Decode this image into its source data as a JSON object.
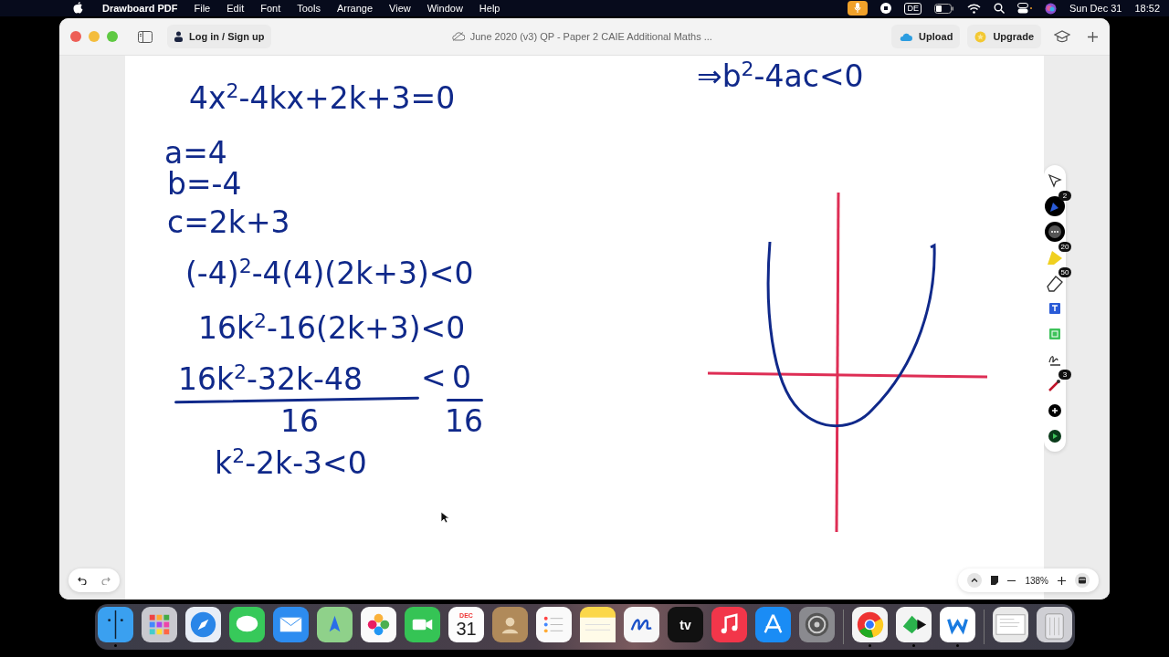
{
  "menu_bar": {
    "app_name": "Drawboard PDF",
    "menus": [
      "File",
      "Edit",
      "Font",
      "Tools",
      "Arrange",
      "View",
      "Window",
      "Help"
    ],
    "keyboard_layout": "DE",
    "date": "Sun Dec 31",
    "time": "18:52"
  },
  "window": {
    "title": "June 2020 (v3) QP - Paper 2 CAIE Additional Maths ...",
    "login_button": "Log in / Sign up",
    "upload_button": "Upload",
    "upgrade_button": "Upgrade"
  },
  "page": {
    "lines": [
      {
        "kind": "line",
        "text": "⇒b$^{2}$-4ac<0"
      },
      {
        "kind": "line",
        "text": "4x$^{2}$-4kx+2k+3=0"
      },
      {
        "kind": "line",
        "text": "a=4"
      },
      {
        "kind": "line",
        "text": "b=-4"
      },
      {
        "kind": "line",
        "text": "c=2k+3"
      },
      {
        "kind": "line",
        "text": "(-4)$^{2}$-4(4)(2k+3)<0"
      },
      {
        "kind": "line",
        "text": "16k$^{2}$-16(2k+3)<0"
      },
      {
        "kind": "fraction",
        "numerator": "16k$^{2}$-32k-48",
        "denominator": "16",
        "relation": "<",
        "rhs_numerator": "0",
        "rhs_denominator": "16"
      },
      {
        "kind": "line",
        "text": "k$^{2}$-2k-3<0"
      }
    ]
  },
  "tools": [
    {
      "kind": "select",
      "selected": false
    },
    {
      "kind": "pen",
      "selected": true,
      "badge": "2"
    },
    {
      "kind": "more",
      "selected": true
    },
    {
      "kind": "highlighter",
      "selected": false,
      "badge": "20"
    },
    {
      "kind": "eraser",
      "selected": false,
      "badge": "50"
    },
    {
      "kind": "text",
      "selected": false
    },
    {
      "kind": "shape",
      "selected": false
    },
    {
      "kind": "signature",
      "selected": false
    },
    {
      "kind": "laser",
      "selected": false,
      "badge": "3"
    },
    {
      "kind": "add",
      "selected": false
    },
    {
      "kind": "record",
      "selected": false
    }
  ],
  "zoom": {
    "level_text": "138%"
  },
  "dock": [
    {
      "kind": "finder",
      "running": true
    },
    {
      "kind": "launchpad",
      "running": false
    },
    {
      "kind": "safari",
      "running": false
    },
    {
      "kind": "messages",
      "running": false
    },
    {
      "kind": "mail",
      "running": false
    },
    {
      "kind": "maps",
      "running": false
    },
    {
      "kind": "photos",
      "running": false
    },
    {
      "kind": "facetime",
      "running": false
    },
    {
      "kind": "calendar",
      "running": false,
      "month": "DEC",
      "day": "31"
    },
    {
      "kind": "contacts",
      "running": false
    },
    {
      "kind": "reminders",
      "running": false
    },
    {
      "kind": "notes",
      "running": false
    },
    {
      "kind": "freeform",
      "running": false
    },
    {
      "kind": "tv",
      "running": false,
      "label": "tv"
    },
    {
      "kind": "music",
      "running": false
    },
    {
      "kind": "appstore",
      "running": false
    },
    {
      "kind": "settings",
      "running": false
    },
    {
      "kind": "separator"
    },
    {
      "kind": "chrome",
      "running": true
    },
    {
      "kind": "feedly",
      "running": true
    },
    {
      "kind": "w",
      "running": true
    },
    {
      "kind": "separator"
    },
    {
      "kind": "window",
      "running": false
    },
    {
      "kind": "trash",
      "running": false
    }
  ]
}
